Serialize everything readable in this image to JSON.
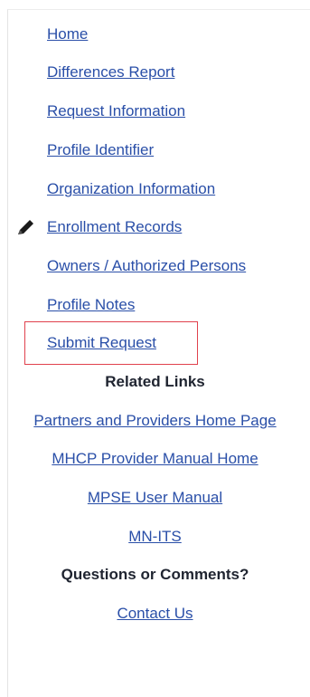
{
  "nav": {
    "items": [
      {
        "label": "Home"
      },
      {
        "label": "Differences Report"
      },
      {
        "label": "Request Information"
      },
      {
        "label": "Profile Identifier"
      },
      {
        "label": "Organization Information"
      },
      {
        "label": "Enrollment Records",
        "current": true
      },
      {
        "label": "Owners / Authorized Persons"
      },
      {
        "label": "Profile Notes"
      },
      {
        "label": "Submit Request",
        "highlighted": true
      }
    ]
  },
  "related": {
    "heading": "Related Links",
    "links": [
      {
        "label": "Partners and Providers Home Page"
      },
      {
        "label": "MHCP Provider Manual Home"
      },
      {
        "label": "MPSE User Manual"
      },
      {
        "label": "MN-ITS"
      }
    ]
  },
  "questions": {
    "heading": "Questions or Comments?",
    "contact_label": "Contact Us"
  },
  "colors": {
    "link": "#2a4fa8",
    "highlight_border": "#e0414d"
  },
  "icons": {
    "current_item": "pencil-icon"
  }
}
